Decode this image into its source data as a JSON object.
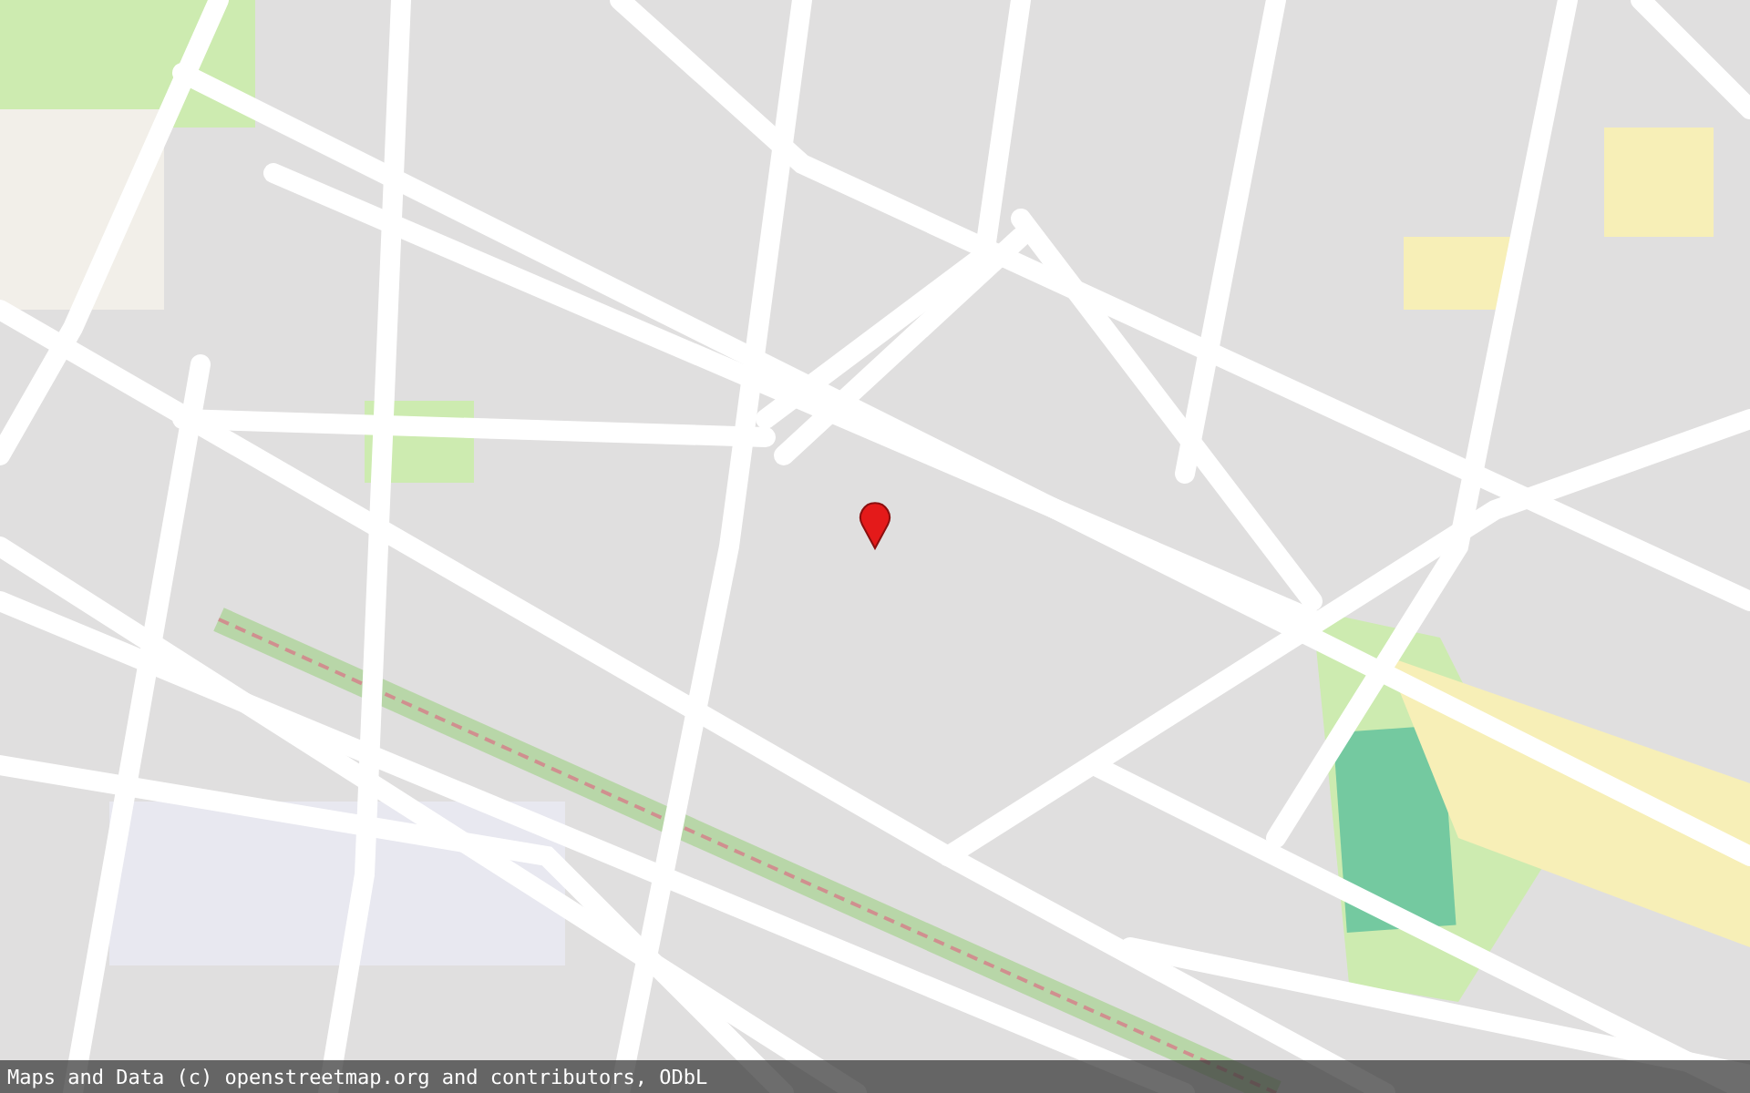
{
  "attribution": {
    "text": "Maps and Data (c) openstreetmap.org and contributors, ODbL"
  }
}
